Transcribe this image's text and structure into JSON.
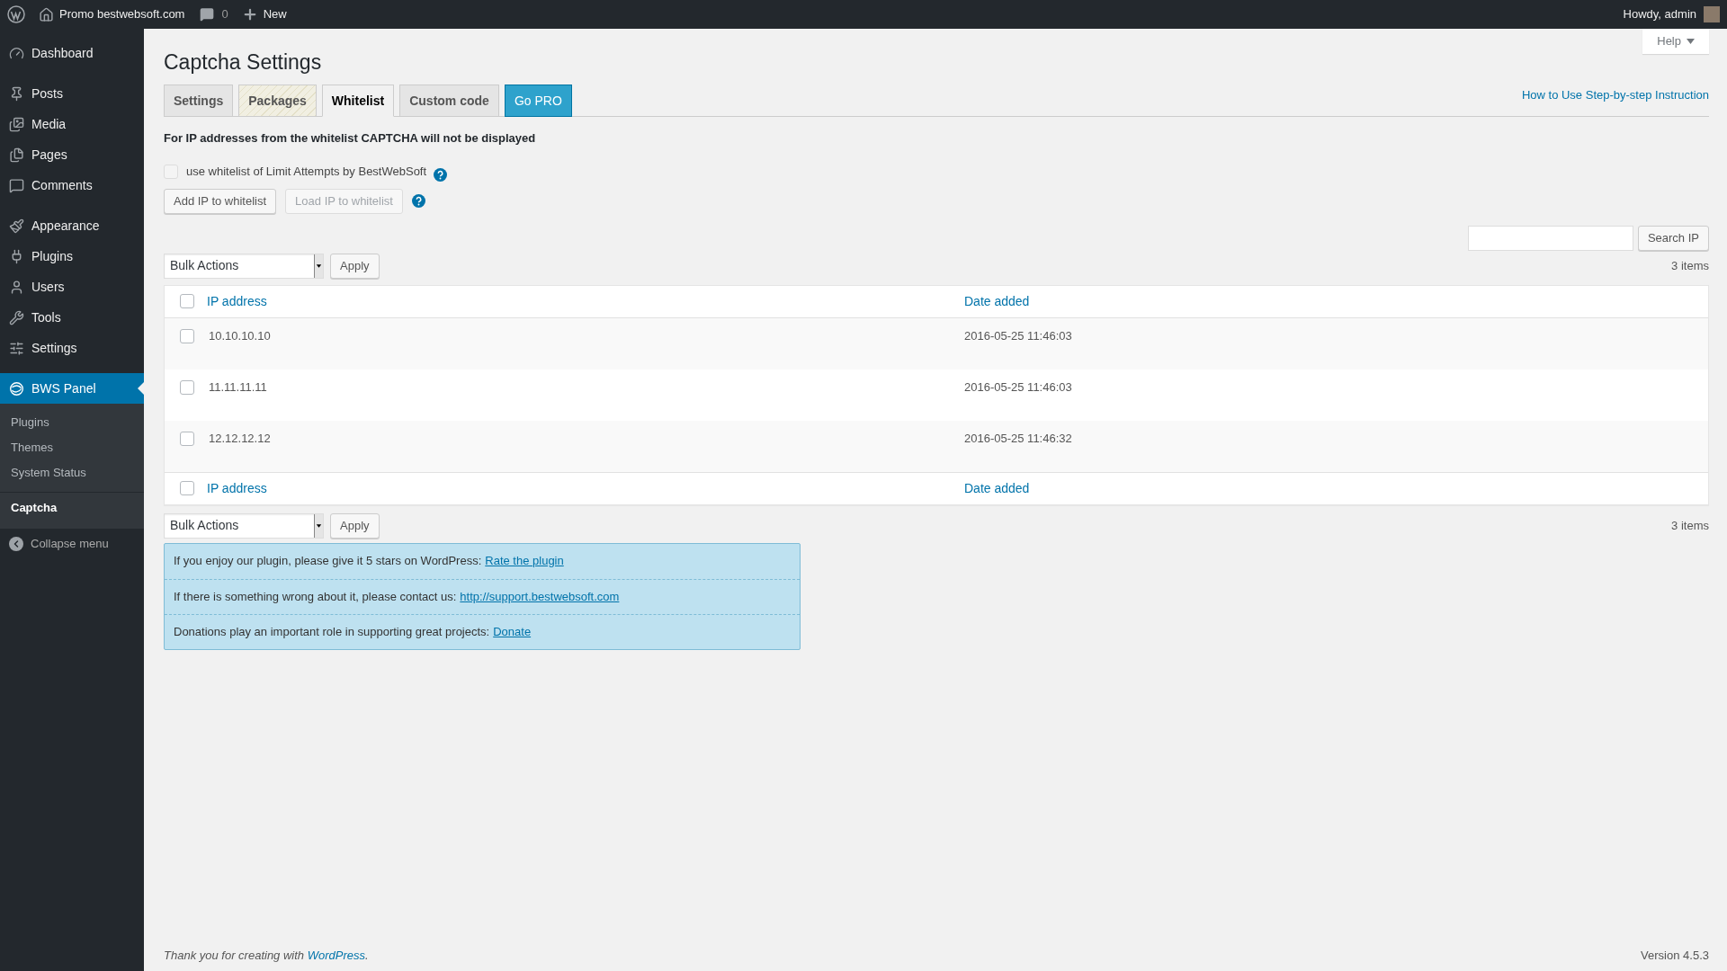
{
  "admin_bar": {
    "site": "Promo bestwebsoft.com",
    "comments": "0",
    "new": "New",
    "greeting": "Howdy, admin"
  },
  "sidebar": {
    "groups": [
      [
        {
          "label": "Dashboard",
          "selected": false
        }
      ],
      [
        {
          "label": "Posts",
          "selected": false
        },
        {
          "label": "Media",
          "selected": false
        },
        {
          "label": "Pages",
          "selected": false
        },
        {
          "label": "Comments",
          "selected": false
        }
      ],
      [
        {
          "label": "Appearance",
          "selected": false
        },
        {
          "label": "Plugins",
          "selected": false
        },
        {
          "label": "Users",
          "selected": false
        },
        {
          "label": "Tools",
          "selected": false
        },
        {
          "label": "Settings",
          "selected": false
        }
      ],
      [
        {
          "label": "BWS Panel",
          "selected": true,
          "children": [
            {
              "label": "Plugins",
              "selected": false
            },
            {
              "label": "Themes",
              "selected": false
            },
            {
              "label": "System Status",
              "selected": false
            }
          ]
        }
      ],
      [
        {
          "label": "Captcha",
          "selected": true
        }
      ]
    ],
    "collapse": "Collapse menu"
  },
  "help": "Help",
  "title": "Captcha Settings",
  "tabs": [
    {
      "label": "Settings",
      "kind": "normal",
      "selected": false
    },
    {
      "label": "Packages",
      "kind": "pro",
      "selected": false
    },
    {
      "label": "Whitelist",
      "kind": "normal",
      "selected": true
    },
    {
      "label": "Custom code",
      "kind": "normal",
      "selected": false
    },
    {
      "label": "Go PRO",
      "kind": "promo",
      "selected": false
    }
  ],
  "instruction_link": "How to Use Step-by-step Instruction",
  "description": "For IP addresses from the whitelist CAPTCHA will not be displayed",
  "option": {
    "label": "use whitelist of Limit Attempts by BestWebSoft",
    "checked": false,
    "disabled": true
  },
  "buttons": [
    {
      "label": "Add IP to whitelist",
      "disabled": false
    },
    {
      "label": "Load IP to whitelist",
      "disabled": true
    }
  ],
  "search": {
    "button": "Search IP"
  },
  "bulk_top": {
    "select": "Bulk Actions",
    "apply": "Apply",
    "count": "3 items"
  },
  "table": {
    "select_all": false,
    "columns": [
      "IP address",
      "Date added"
    ],
    "footer_select_all": false,
    "rows": [
      {
        "ip": "10.10.10.10",
        "date": "2016-05-25 11:46:03",
        "checked": false
      },
      {
        "ip": "11.11.11.11",
        "date": "2016-05-25 11:46:03",
        "checked": false
      },
      {
        "ip": "12.12.12.12",
        "date": "2016-05-25 11:46:32",
        "checked": false
      }
    ],
    "footer_columns": [
      "IP address",
      "Date added"
    ]
  },
  "bulk_bottom": {
    "select": "Bulk Actions",
    "apply": "Apply",
    "count": "3 items"
  },
  "notice": [
    {
      "text": "If you enjoy our plugin, please give it 5 stars on WordPress:",
      "link": "Rate the plugin"
    },
    {
      "text": "If there is something wrong about it, please contact us:",
      "link": "http://support.bestwebsoft.com"
    },
    {
      "text": "Donations play an important role in supporting great projects:",
      "link": "Donate"
    }
  ],
  "footer": {
    "text": "Thank you for creating with",
    "link": "WordPress",
    "after": ".",
    "version": "Version 4.5.3"
  }
}
